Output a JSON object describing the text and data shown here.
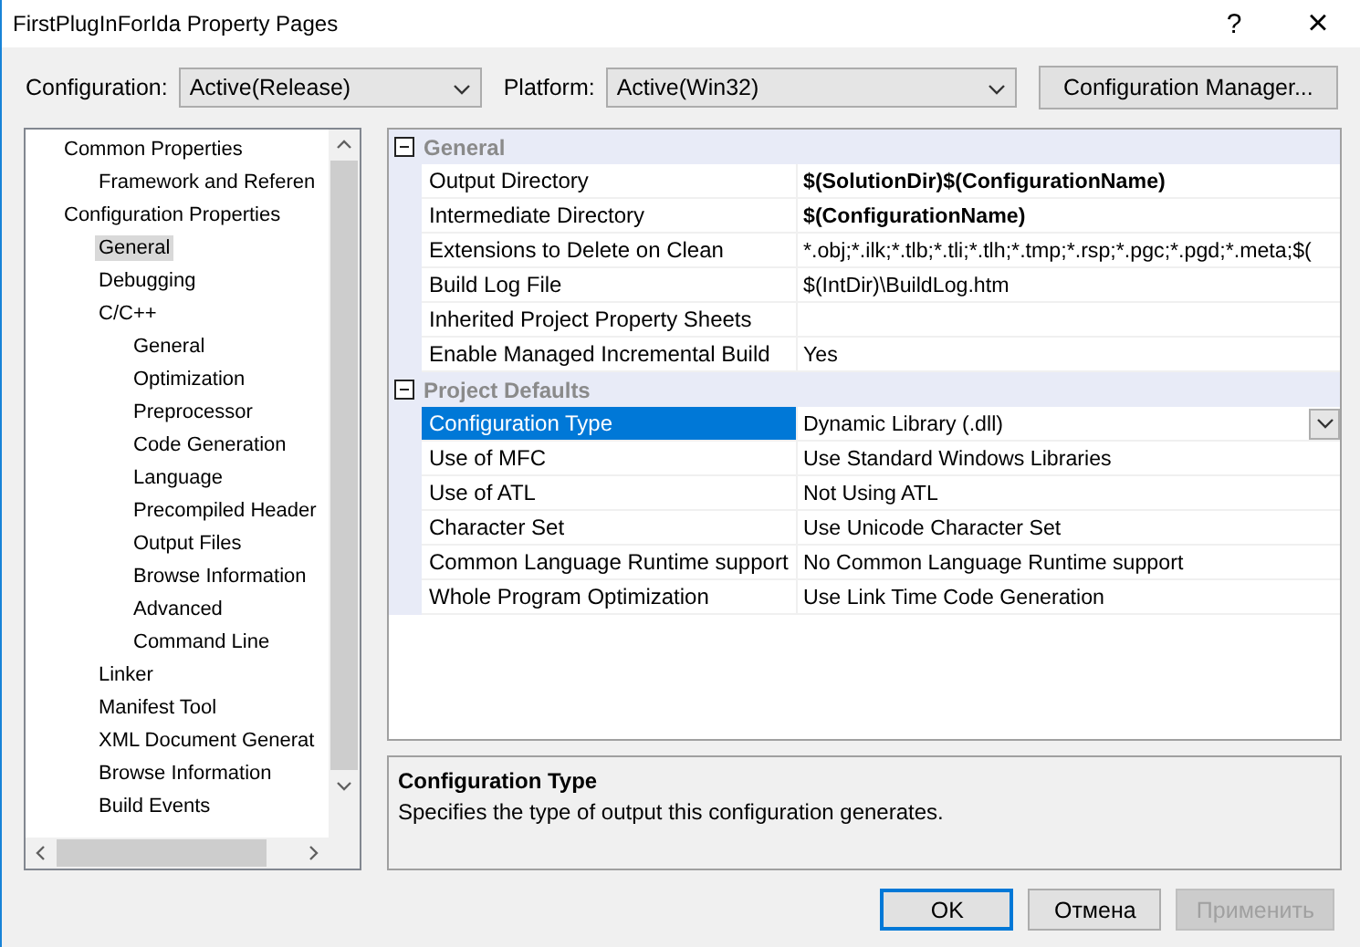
{
  "window": {
    "title": "FirstPlugInForIda Property Pages",
    "help": "?",
    "close": "×"
  },
  "toolbar": {
    "configuration_label": "Configuration:",
    "configuration": "Active(Release)",
    "platform_label": "Platform:",
    "platform": "Active(Win32)",
    "manager_button": "Configuration Manager..."
  },
  "tree": [
    {
      "label": "Common Properties",
      "selected": false,
      "children": [
        {
          "label": "Framework and Referen",
          "selected": false
        }
      ]
    },
    {
      "label": "Configuration Properties",
      "selected": false,
      "children": [
        {
          "label": "General",
          "selected": true
        },
        {
          "label": "Debugging",
          "selected": false
        },
        {
          "label": "C/C++",
          "selected": false,
          "children": [
            {
              "label": "General",
              "selected": false
            },
            {
              "label": "Optimization",
              "selected": false
            },
            {
              "label": "Preprocessor",
              "selected": false
            },
            {
              "label": "Code Generation",
              "selected": false
            },
            {
              "label": "Language",
              "selected": false
            },
            {
              "label": "Precompiled Header",
              "selected": false
            },
            {
              "label": "Output Files",
              "selected": false
            },
            {
              "label": "Browse Information",
              "selected": false
            },
            {
              "label": "Advanced",
              "selected": false
            },
            {
              "label": "Command Line",
              "selected": false
            }
          ]
        },
        {
          "label": "Linker",
          "selected": false
        },
        {
          "label": "Manifest Tool",
          "selected": false
        },
        {
          "label": "XML Document Generat",
          "selected": false
        },
        {
          "label": "Browse Information",
          "selected": false
        },
        {
          "label": "Build Events",
          "selected": false
        }
      ]
    }
  ],
  "grid": [
    {
      "category": "General",
      "expanded": true,
      "properties": [
        {
          "name": "Output Directory",
          "value": "$(SolutionDir)$(ConfigurationName)",
          "bold": true,
          "selected": false
        },
        {
          "name": "Intermediate Directory",
          "value": "$(ConfigurationName)",
          "bold": true,
          "selected": false
        },
        {
          "name": "Extensions to Delete on Clean",
          "value": "*.obj;*.ilk;*.tlb;*.tli;*.tlh;*.tmp;*.rsp;*.pgc;*.pgd;*.meta;$(",
          "bold": false,
          "selected": false
        },
        {
          "name": "Build Log File",
          "value": "$(IntDir)\\BuildLog.htm",
          "bold": false,
          "selected": false
        },
        {
          "name": "Inherited Project Property Sheets",
          "selected": false
        },
        {
          "name": "Enable Managed Incremental Build",
          "value": "Yes",
          "bold": false,
          "selected": false
        }
      ]
    },
    {
      "category": "Project Defaults",
      "expanded": true,
      "properties": [
        {
          "name": "Configuration Type",
          "value": "Dynamic Library (.dll)",
          "bold": false,
          "selected": true
        },
        {
          "name": "Use of MFC",
          "value": "Use Standard Windows Libraries",
          "bold": false,
          "selected": false
        },
        {
          "name": "Use of ATL",
          "value": "Not Using ATL",
          "bold": false,
          "selected": false
        },
        {
          "name": "Character Set",
          "value": "Use Unicode Character Set",
          "bold": false,
          "selected": false
        },
        {
          "name": "Common Language Runtime support",
          "value": "No Common Language Runtime support",
          "bold": false,
          "selected": false
        },
        {
          "name": "Whole Program Optimization",
          "value": "Use Link Time Code Generation",
          "bold": false,
          "selected": false
        }
      ]
    }
  ],
  "description": {
    "title": "Configuration Type",
    "text": "Specifies the type of output this configuration generates."
  },
  "buttons": [
    {
      "label": "OK",
      "kind": "default",
      "disabled": false
    },
    {
      "label": "Отмена",
      "kind": "normal",
      "disabled": false
    },
    {
      "label": "Применить",
      "kind": "normal",
      "disabled": true
    }
  ]
}
